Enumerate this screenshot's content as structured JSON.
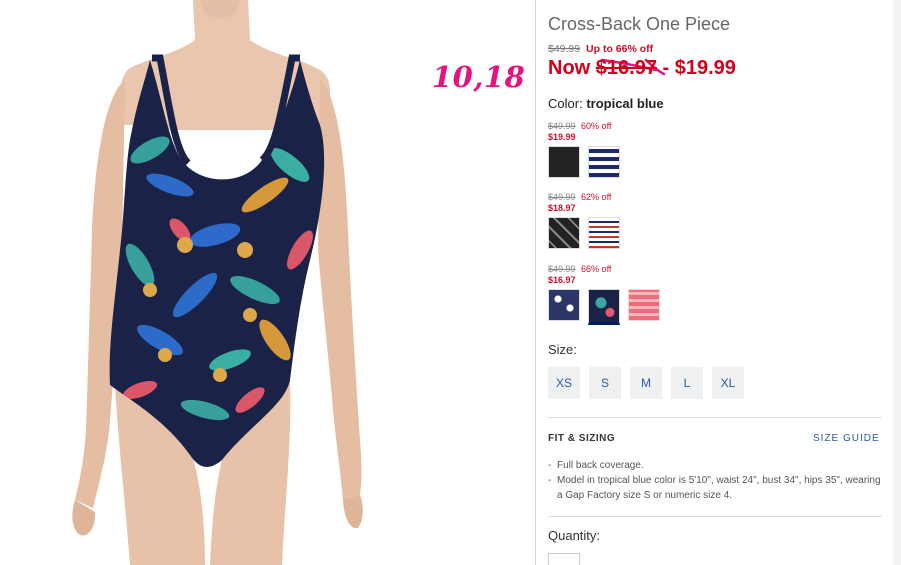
{
  "product": {
    "title": "Cross-Back One Piece",
    "original_price": "$49.99",
    "promo": "Up to 66% off",
    "now_label": "Now",
    "now_low": "$16.97",
    "now_sep": " - ",
    "now_high": "$19.99"
  },
  "annotation": {
    "handwritten_price": "10,18"
  },
  "color": {
    "label": "Color:",
    "value": "tropical blue"
  },
  "swatch_groups": [
    {
      "original": "$49.99",
      "off": "60% off",
      "sale": "$19.99",
      "swatches": [
        "black",
        "navy-stripe"
      ]
    },
    {
      "original": "$49.99",
      "off": "62% off",
      "sale": "$18.97",
      "swatches": [
        "black-geo-print",
        "multi-stripe"
      ]
    },
    {
      "original": "$49.99",
      "off": "66% off",
      "sale": "$16.97",
      "swatches": [
        "navy-floral",
        "tropical-blue",
        "coral-stripe"
      ]
    }
  ],
  "size": {
    "label": "Size:",
    "options": [
      "XS",
      "S",
      "M",
      "L",
      "XL"
    ]
  },
  "fit": {
    "title": "FIT & SIZING",
    "guide_link": "SIZE GUIDE",
    "bullets": [
      "Full back coverage.",
      "Model in tropical blue color is 5'10\", waist 24\", bust 34\", hips 35\", wearing a Gap Factory size S or numeric size 4."
    ]
  },
  "quantity": {
    "label": "Quantity:"
  },
  "colors": {
    "sale_red": "#d0021b",
    "link_blue": "#2c5aa0",
    "annotation_pink": "#e6127d",
    "selected_underline": "#001f5b"
  },
  "icons": {
    "swatch_selected_marker": "underline-bar"
  }
}
